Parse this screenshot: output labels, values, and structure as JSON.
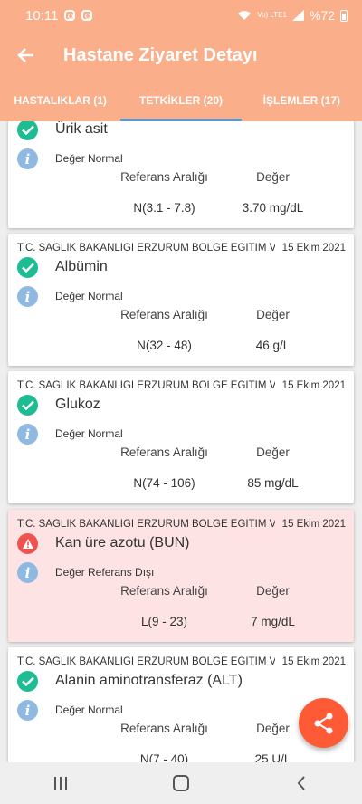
{
  "status_bar": {
    "time": "10:11",
    "network": "Vo) LTE1",
    "battery": "%72"
  },
  "header": {
    "title": "Hastane Ziyaret Detayı"
  },
  "tabs": [
    {
      "label": "HASTALIKLAR (1)",
      "active": false
    },
    {
      "label": "TETKİKLER (20)",
      "active": true
    },
    {
      "label": "İŞLEMLER (17)",
      "active": false
    }
  ],
  "columns": {
    "range": "Referans Aralığı",
    "value": "Değer"
  },
  "colors": {
    "primary": "#fbae8a",
    "normal": "#1ebc93",
    "warning": "#ef5350",
    "info": "#8fb9e0",
    "fab": "#ff5a36",
    "alert_bg": "#fde3e3"
  },
  "tests": [
    {
      "hospital": "",
      "date": "",
      "name": "Ürik asit",
      "result": "Değer Normal",
      "status": "normal",
      "range": "N(3.1 - 7.8)",
      "value": "3.70 mg/dL"
    },
    {
      "hospital": "T.C. SAĞLIK BAKANLIĞI ERZURUM BÖLGE EĞİTİM VE",
      "date": "15 Ekim 2021",
      "name": "Albümin",
      "result": "Değer Normal",
      "status": "normal",
      "range": "N(32 - 48)",
      "value": "46 g/L"
    },
    {
      "hospital": "T.C. SAĞLIK BAKANLIĞI ERZURUM BÖLGE EĞİTİM VE",
      "date": "15 Ekim 2021",
      "name": "Glukoz",
      "result": "Değer Normal",
      "status": "normal",
      "range": "N(74 - 106)",
      "value": "85 mg/dL"
    },
    {
      "hospital": "T.C. SAĞLIK BAKANLIĞI ERZURUM BÖLGE EĞİTİM VE",
      "date": "15 Ekim 2021",
      "name": "Kan üre azotu (BUN)",
      "result": "Değer Referans Dışı",
      "status": "alert",
      "range": "L(9 - 23)",
      "value": "7 mg/dL"
    },
    {
      "hospital": "T.C. SAĞLIK BAKANLIĞI ERZURUM BÖLGE EĞİTİM VE",
      "date": "15 Ekim 2021",
      "name": "Alanin aminotransferaz (ALT)",
      "result": "Değer Normal",
      "status": "normal",
      "range": "N(7 - 40)",
      "value": "25 U/L"
    }
  ],
  "icons": {
    "back": "arrow-left-icon",
    "share": "share-icon",
    "normal": "check-circle-icon",
    "alert": "warning-triangle-icon",
    "info": "info-icon"
  }
}
